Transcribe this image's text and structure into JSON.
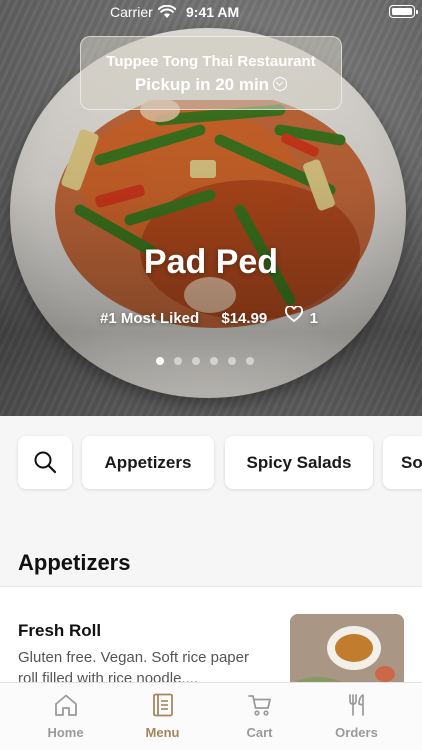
{
  "status_bar": {
    "carrier": "Carrier",
    "time": "9:41 AM"
  },
  "restaurant": {
    "name": "Tuppee Tong Thai Restaurant",
    "pickup": "Pickup in 20 min"
  },
  "featured": {
    "dish_name": "Pad Ped",
    "rank": "#1 Most Liked",
    "price": "$14.99",
    "likes": "1",
    "slide_count": 6,
    "active_slide": 1
  },
  "categories": [
    "Appetizers",
    "Spicy Salads",
    "So"
  ],
  "section": {
    "title": "Appetizers"
  },
  "menu_item": {
    "name": "Fresh Roll",
    "description": "Gluten free. Vegan. Soft rice paper roll filled with rice noodle...."
  },
  "tabs": [
    {
      "label": "Home",
      "icon": "home-icon",
      "active": false
    },
    {
      "label": "Menu",
      "icon": "menu-book-icon",
      "active": true
    },
    {
      "label": "Cart",
      "icon": "cart-icon",
      "active": false
    },
    {
      "label": "Orders",
      "icon": "fork-knife-icon",
      "active": false
    }
  ],
  "colors": {
    "accent": "#a5865c",
    "inactive_tab": "#9a9a9a",
    "text": "#111111"
  }
}
